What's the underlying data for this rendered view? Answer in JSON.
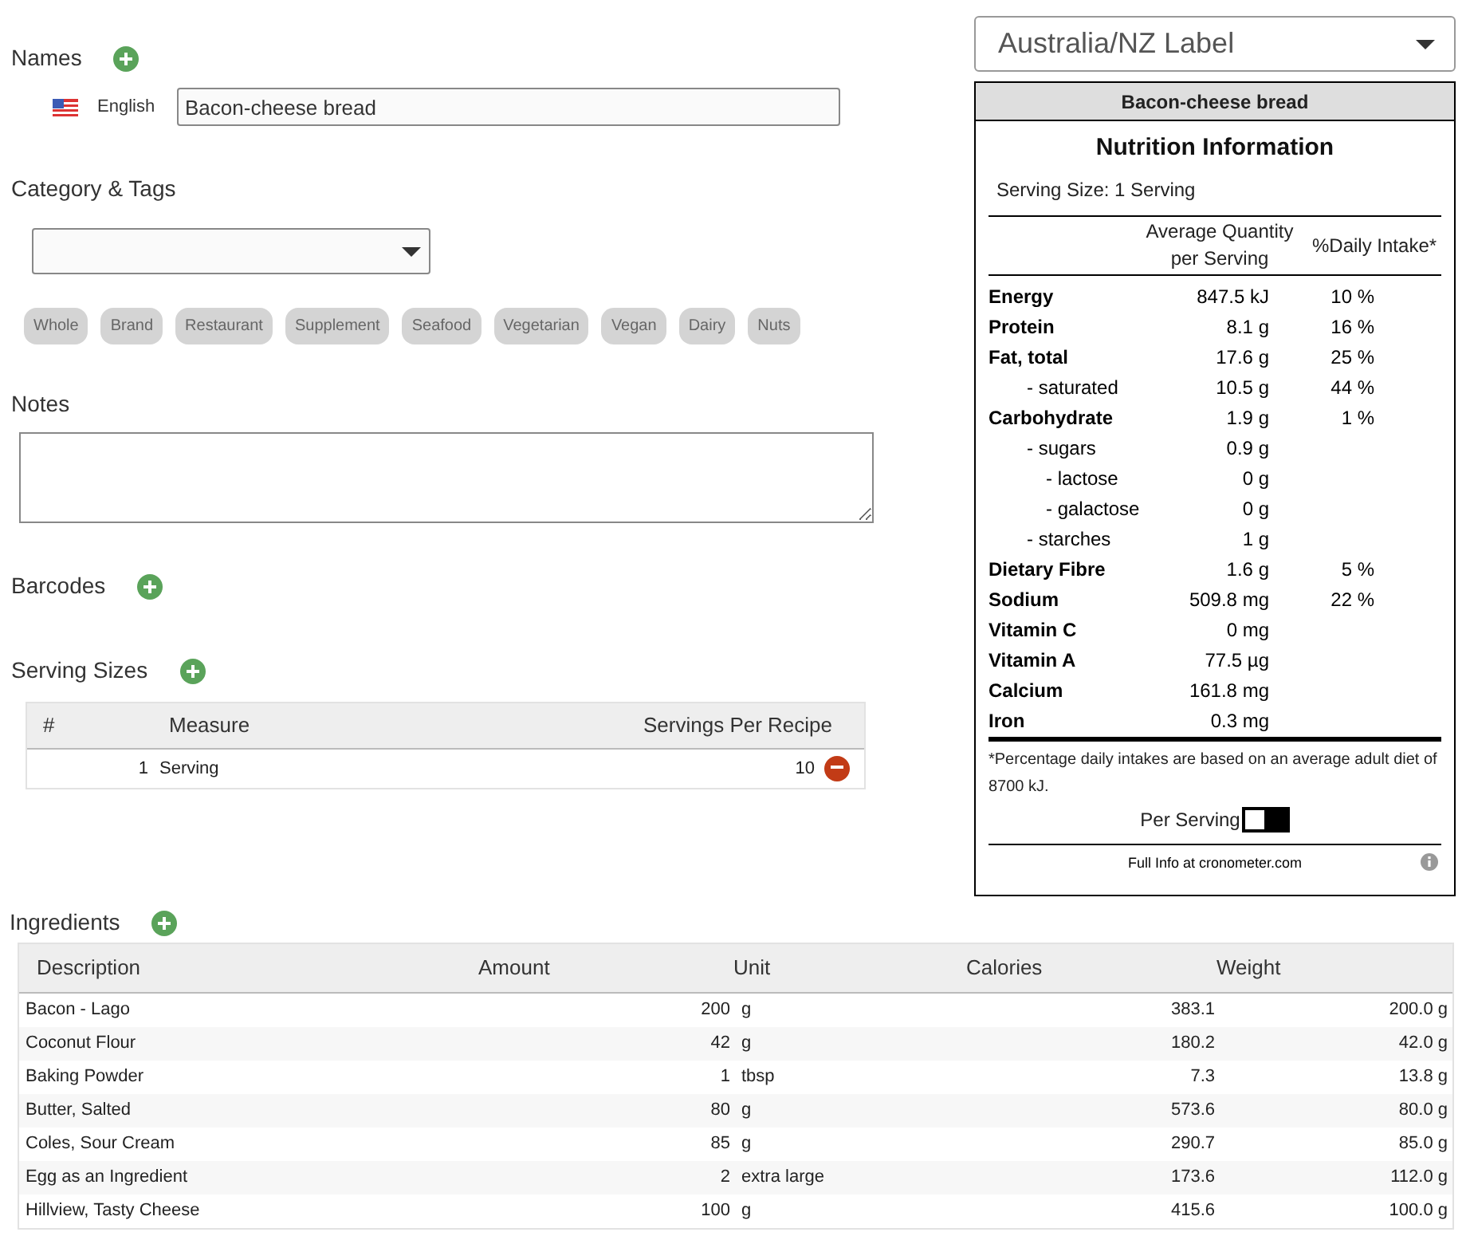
{
  "names": {
    "title": "Names",
    "language": "English",
    "value": "Bacon-cheese bread"
  },
  "category": {
    "title": "Category & Tags",
    "tags": [
      "Whole",
      "Brand",
      "Restaurant",
      "Supplement",
      "Seafood",
      "Vegetarian",
      "Vegan",
      "Dairy",
      "Nuts"
    ]
  },
  "notes": {
    "title": "Notes"
  },
  "barcodes": {
    "title": "Barcodes"
  },
  "serving_sizes": {
    "title": "Serving Sizes",
    "columns": [
      "#",
      "Measure",
      "Servings Per Recipe"
    ],
    "rows": [
      {
        "number": "1",
        "measure": "Serving",
        "servings": "10"
      }
    ]
  },
  "label": {
    "format": "Australia/NZ Label",
    "food": "Bacon-cheese bread",
    "title": "Nutrition Information",
    "serving_size": "Serving Size: 1 Serving",
    "quantity_header": "Average Quantity per Serving",
    "intake_header": "%Daily Intake*",
    "rows": [
      {
        "name": "Energy",
        "amount": "847.5 kJ",
        "intake": "10 %"
      },
      {
        "name": "Protein",
        "amount": "8.1 g",
        "intake": "16 %"
      },
      {
        "name": "Fat, total",
        "amount": "17.6 g",
        "intake": "25 %",
        "children": [
          {
            "name": "- saturated",
            "amount": "10.5 g",
            "intake": "44 %"
          }
        ]
      },
      {
        "name": "Carbohydrate",
        "amount": "1.9 g",
        "intake": "1 %",
        "children": [
          {
            "name": "- sugars",
            "amount": "0.9 g",
            "children": [
              {
                "name": "- lactose",
                "amount": "0 g"
              },
              {
                "name": "- galactose",
                "amount": "0 g"
              }
            ]
          },
          {
            "name": "- starches",
            "amount": "1 g"
          }
        ]
      },
      {
        "name": "Dietary Fibre",
        "amount": "1.6 g",
        "intake": "5 %"
      },
      {
        "name": "Sodium",
        "amount": "509.8 mg",
        "intake": "22 %"
      },
      {
        "name": "Vitamin C",
        "amount": "0 mg"
      },
      {
        "name": "Vitamin A",
        "amount": "77.5 µg"
      },
      {
        "name": "Calcium",
        "amount": "161.8 mg"
      },
      {
        "name": "Iron",
        "amount": "0.3 mg"
      }
    ],
    "footnote": "*Percentage daily intakes are based on an average adult diet of 8700 kJ.",
    "toggle": {
      "label": "Per Serving",
      "on": false
    },
    "link": "Full Info at cronometer.com"
  },
  "ingredients": {
    "title": "Ingredients",
    "columns": [
      "Description",
      "Amount",
      "Unit",
      "Calories",
      "Weight"
    ],
    "rows": [
      {
        "description": "Bacon - Lago",
        "amount": "200",
        "unit": "g",
        "calories": "383.1",
        "weight": "200.0 g"
      },
      {
        "description": "Coconut Flour",
        "amount": "42",
        "unit": "g",
        "calories": "180.2",
        "weight": "42.0 g"
      },
      {
        "description": "Baking Powder",
        "amount": "1",
        "unit": "tbsp",
        "calories": "7.3",
        "weight": "13.8 g"
      },
      {
        "description": "Butter, Salted",
        "amount": "80",
        "unit": "g",
        "calories": "573.6",
        "weight": "80.0 g"
      },
      {
        "description": "Coles, Sour Cream",
        "amount": "85",
        "unit": "g",
        "calories": "290.7",
        "weight": "85.0 g"
      },
      {
        "description": "Egg as an Ingredient",
        "amount": "2",
        "unit": "extra large",
        "calories": "173.6",
        "weight": "112.0 g"
      },
      {
        "description": "Hillview, Tasty Cheese",
        "amount": "100",
        "unit": "g",
        "calories": "415.6",
        "weight": "100.0 g"
      }
    ]
  }
}
